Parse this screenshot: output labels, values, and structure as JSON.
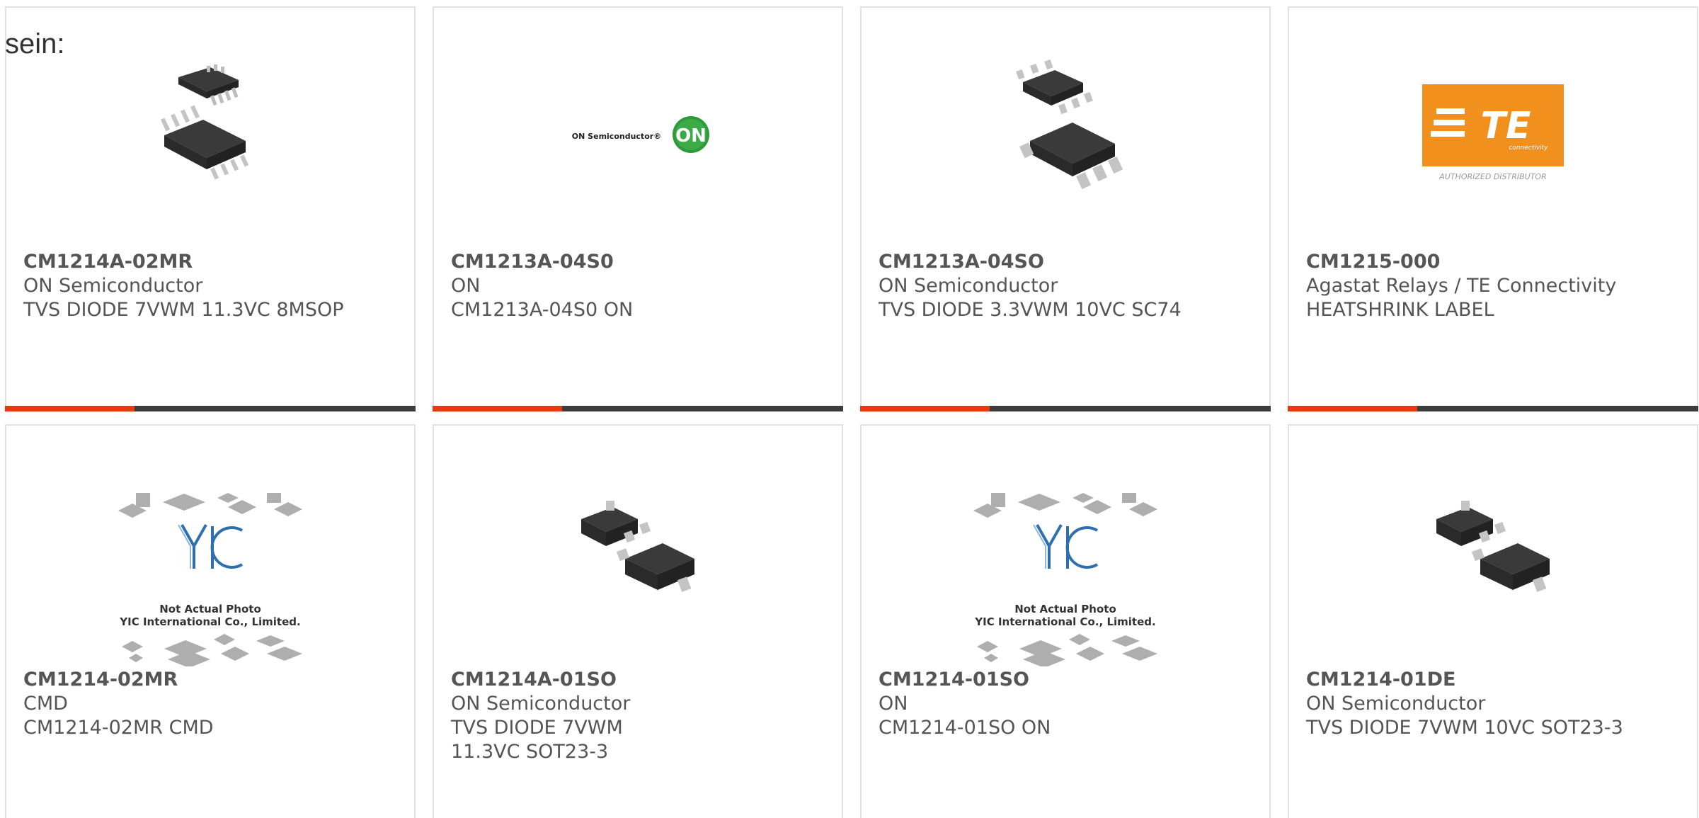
{
  "intro_text": "sein:",
  "colors": {
    "accent": "#e8380d",
    "bar": "#3c3c3c",
    "card_border": "#e2e2e2",
    "text": "#555555",
    "te_orange": "#f2901e",
    "on_green": "#2e9a3a",
    "yic_blue": "#2d6fb0"
  },
  "products": [
    {
      "part": "CM1214A-02MR",
      "maker": "ON Semiconductor",
      "desc": "TVS DIODE 7VWM 11.3VC 8MSOP",
      "image": "msop8-package-icon"
    },
    {
      "part": "CM1213A-04S0",
      "maker": "ON",
      "desc": "CM1213A-04S0 ON",
      "image": "on-semiconductor-logo",
      "logo_text": "ON Semiconductor®",
      "logo_badge": "ON"
    },
    {
      "part": "CM1213A-04SO",
      "maker": "ON Semiconductor",
      "desc": "TVS DIODE 3.3VWM 10VC SC74",
      "image": "sc74-package-icon"
    },
    {
      "part": "CM1215-000",
      "maker": "Agastat Relays / TE Connectivity",
      "desc": "HEATSHRINK LABEL",
      "image": "te-connectivity-logo",
      "logo_text": "TE",
      "logo_sub": "connectivity",
      "logo_caption": "AUTHORIZED DISTRIBUTOR"
    },
    {
      "part": "CM1214-02MR",
      "maker": "CMD",
      "desc": "CM1214-02MR CMD",
      "image": "yic-placeholder-image",
      "logo_text": "YIC",
      "caption_line1": "Not Actual Photo",
      "caption_line2": "YIC International Co., Limited."
    },
    {
      "part": "CM1214A-01SO",
      "maker": "ON Semiconductor",
      "desc": "TVS DIODE 7VWM 11.3VC SOT23-3",
      "image": "sot23-package-icon"
    },
    {
      "part": "CM1214-01SO",
      "maker": "ON",
      "desc": "CM1214-01SO ON",
      "image": "yic-placeholder-image",
      "logo_text": "YIC",
      "caption_line1": "Not Actual Photo",
      "caption_line2": "YIC International Co., Limited."
    },
    {
      "part": "CM1214-01DE",
      "maker": "ON Semiconductor",
      "desc": "TVS DIODE 7VWM 10VC SOT23-3",
      "image": "sot23-package-icon"
    }
  ]
}
